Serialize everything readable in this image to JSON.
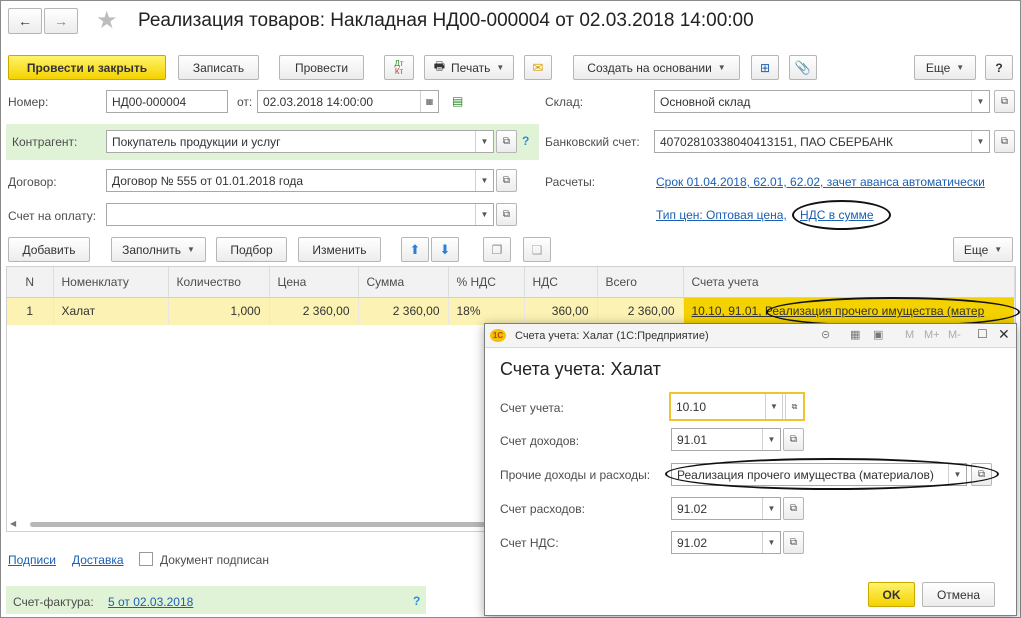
{
  "window": {
    "title": "Реализация товаров: Накладная НД00-000004 от 02.03.2018 14:00:00"
  },
  "toolbar": {
    "post_close": "Провести и закрыть",
    "save": "Записать",
    "post": "Провести",
    "dtkt": "Дт Кт",
    "print": "Печать",
    "create_based": "Создать на основании",
    "more": "Еще",
    "help": "?"
  },
  "form": {
    "number_label": "Номер:",
    "number_value": "НД00-000004",
    "date_label": "от:",
    "date_value": "02.03.2018 14:00:00",
    "warehouse_label": "Склад:",
    "warehouse_value": "Основной склад",
    "counterparty_label": "Контрагент:",
    "counterparty_value": "Покупатель продукции и услуг",
    "bank_label": "Банковский счет:",
    "bank_value": "40702810338040413151, ПАО СБЕРБАНК",
    "contract_label": "Договор:",
    "contract_value": "Договор № 555 от 01.01.2018 года",
    "settlements_label": "Расчеты:",
    "settlements_link": "Срок 01.04.2018, 62.01, 62.02, зачет аванса автоматически",
    "invoice_label": "Счет на оплату:",
    "invoice_value": "",
    "price_type_link": "Тип цен: Оптовая цена,",
    "vat_link": "НДС в сумме"
  },
  "table_toolbar": {
    "add": "Добавить",
    "fill": "Заполнить",
    "pick": "Подбор",
    "change": "Изменить",
    "more": "Еще"
  },
  "table": {
    "headers": [
      "N",
      "Номенклату",
      "Количество",
      "Цена",
      "Сумма",
      "% НДС",
      "НДС",
      "Всего",
      "Счета учета"
    ],
    "rows": [
      [
        "1",
        "Халат",
        "1,000",
        "2 360,00",
        "2 360,00",
        "18%",
        "360,00",
        "2 360,00",
        "10.10, 91.01, Реализация прочего имущества (матер"
      ]
    ]
  },
  "footer": {
    "signatures": "Подписи",
    "delivery": "Доставка",
    "doc_signed": "Документ подписан",
    "invoice_label": "Счет-фактура:",
    "invoice_link": "5 от 02.03.2018",
    "help": "?"
  },
  "modal": {
    "window_title": "Счета учета: Халат  (1С:Предприятие)",
    "heading": "Счета учета: Халат",
    "account_label": "Счет учета:",
    "account_value": "10.10",
    "income_label": "Счет доходов:",
    "income_value": "91.01",
    "other_label": "Прочие доходы и расходы:",
    "other_value": "Реализация прочего имущества (материалов)",
    "expense_label": "Счет расходов:",
    "expense_value": "91.02",
    "vat_label": "Счет НДС:",
    "vat_value": "91.02",
    "ok": "OK",
    "cancel": "Отмена",
    "tb_m": "M",
    "tb_mplus": "M+",
    "tb_mminus": "M-"
  },
  "colors": {
    "primary_button": "#f4d200",
    "selected_row": "#fbf2b4",
    "link": "#1a5fb4",
    "highlight_green": "#e1f3d6"
  }
}
